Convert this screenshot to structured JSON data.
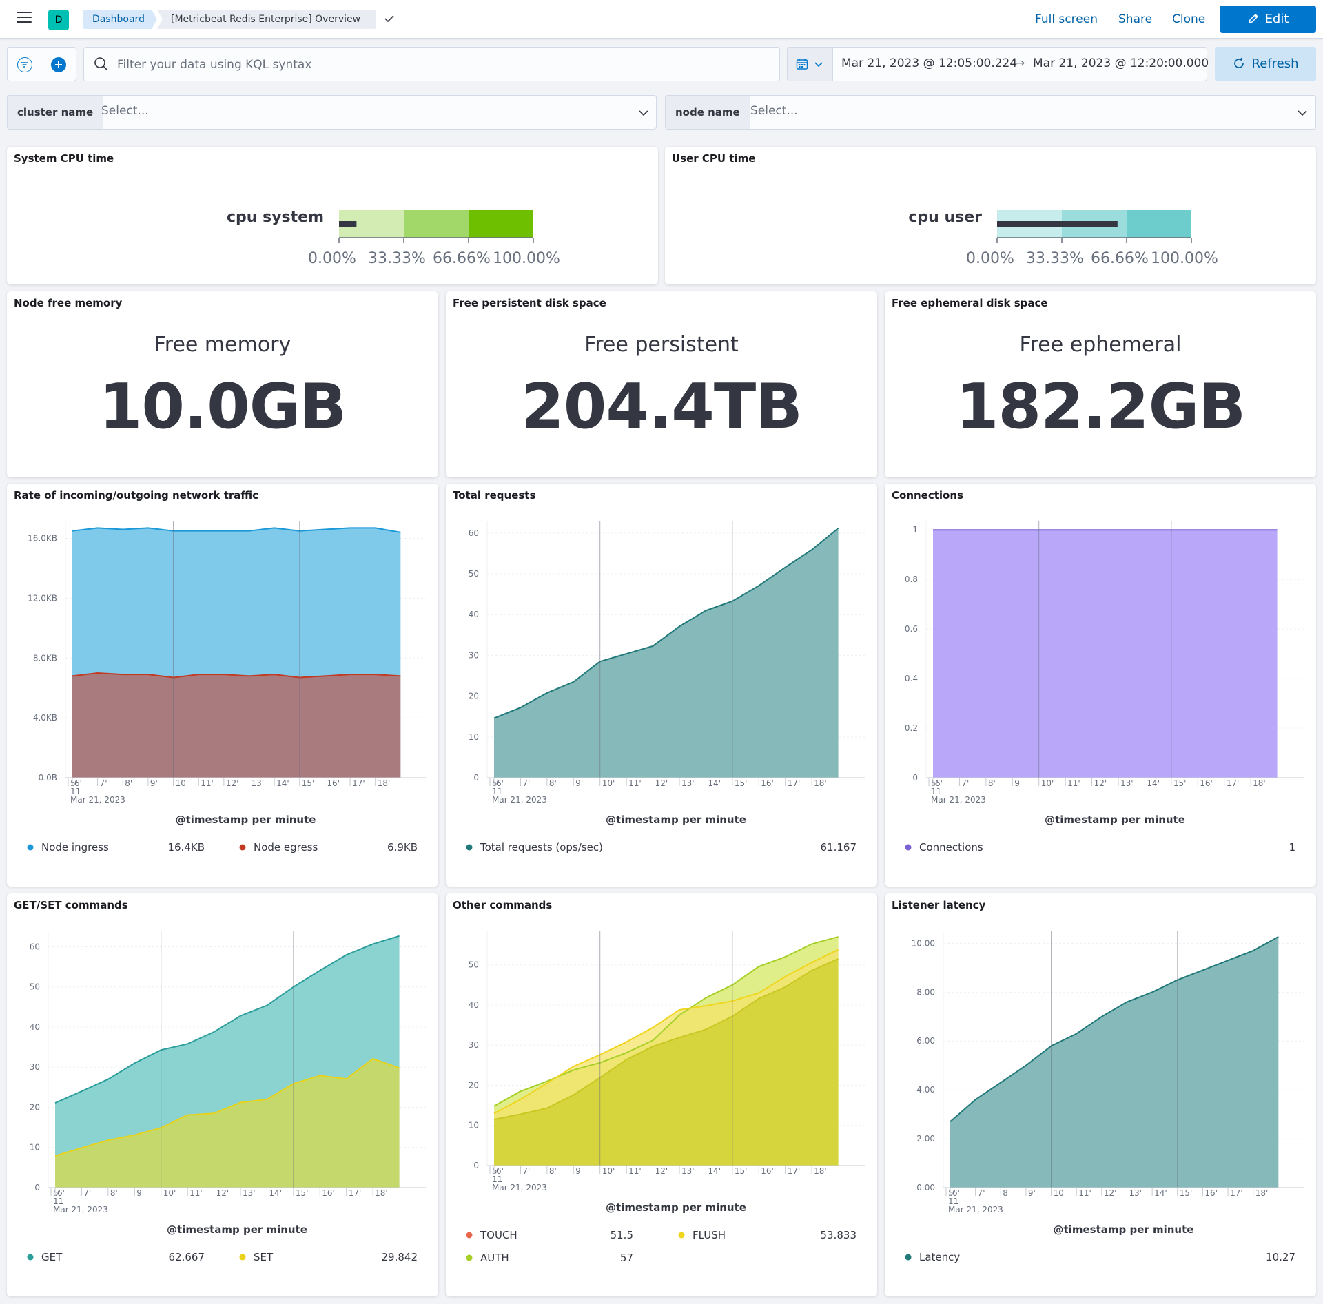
{
  "header": {
    "space_initial": "D",
    "breadcrumb_root": "Dashboard",
    "breadcrumb_current": "[Metricbeat Redis Enterprise] Overview",
    "full_screen_label": "Full screen",
    "share_label": "Share",
    "clone_label": "Clone",
    "edit_label": "Edit"
  },
  "query_bar": {
    "placeholder": "Filter your data using KQL syntax",
    "start_date": "Mar 21, 2023 @ 12:05:00.224",
    "end_date": "Mar 21, 2023 @ 12:20:00.000",
    "arrow": "→",
    "refresh_label": "Refresh"
  },
  "controls": {
    "cluster_label": "cluster name",
    "cluster_value": "Select...",
    "node_label": "node name",
    "node_value": "Select..."
  },
  "gauges": {
    "system": {
      "panel_title": "System CPU time",
      "label": "cpu system",
      "ticks": [
        "0.00%",
        "33.33%",
        "66.66%",
        "100.00%"
      ],
      "value_fraction": 0.09,
      "band_colors": [
        "#d2ecb4",
        "#a2d86a",
        "#6dbf00"
      ]
    },
    "user": {
      "panel_title": "User CPU time",
      "label": "cpu user",
      "ticks": [
        "0.00%",
        "33.33%",
        "66.66%",
        "100.00%"
      ],
      "value_fraction": 0.62,
      "band_colors": [
        "#c6ecec",
        "#9bdddd",
        "#6dcccc"
      ]
    }
  },
  "metrics": {
    "memory": {
      "panel_title": "Node free memory",
      "label": "Free memory",
      "value": "10.0GB"
    },
    "persistent": {
      "panel_title": "Free persistent disk space",
      "label": "Free persistent",
      "value": "204.4TB"
    },
    "ephemeral": {
      "panel_title": "Free ephemeral disk space",
      "label": "Free ephemeral",
      "value": "182.2GB"
    }
  },
  "chart_data": [
    {
      "id": "network",
      "panel_title": "Rate of incoming/outgoing network traffic",
      "type": "area",
      "stacked": true,
      "x": [
        "5'",
        "6'",
        "7'",
        "8'",
        "9'",
        "10'",
        "11'",
        "12'",
        "13'",
        "14'",
        "15'",
        "16'",
        "17'",
        "18'"
      ],
      "x_start_label": "Mar 21, 2023",
      "x_start_sub": "11",
      "xlabel": "@timestamp per minute",
      "y_ticks": [
        "0.0B",
        "4.0KB",
        "8.0KB",
        "12.0KB",
        "16.0KB"
      ],
      "ylim": [
        0,
        16.9
      ],
      "series": [
        {
          "name": "Node egress",
          "color": "#aa7b7e",
          "line": "#c33a22",
          "values": [
            6.8,
            7.0,
            6.9,
            6.9,
            6.7,
            6.9,
            6.9,
            6.8,
            6.9,
            6.7,
            6.8,
            6.9,
            6.9,
            6.8
          ]
        },
        {
          "name": "Node ingress",
          "color": "#7fcaeb",
          "line": "#1b98d8",
          "values": [
            9.7,
            9.7,
            9.7,
            9.8,
            9.8,
            9.6,
            9.6,
            9.7,
            9.8,
            9.8,
            9.8,
            9.8,
            9.8,
            9.6
          ]
        }
      ],
      "legend": [
        {
          "name": "Node ingress",
          "value": "16.4KB",
          "color": "#1b98d8"
        },
        {
          "name": "Node egress",
          "value": "6.9KB",
          "color": "#c33a22"
        }
      ]
    },
    {
      "id": "requests",
      "panel_title": "Total requests",
      "type": "area",
      "x": [
        "5'",
        "6'",
        "7'",
        "8'",
        "9'",
        "10'",
        "11'",
        "12'",
        "13'",
        "14'",
        "15'",
        "16'",
        "17'",
        "18'"
      ],
      "x_start_label": "Mar 21, 2023",
      "x_start_sub": "11",
      "xlabel": "@timestamp per minute",
      "y_ticks": [
        "0",
        "10",
        "20",
        "30",
        "40",
        "50",
        "60"
      ],
      "ylim": [
        0,
        62
      ],
      "series": [
        {
          "name": "Total requests (ops/sec)",
          "color": "#86b9ba",
          "line": "#21797a",
          "values": [
            14.6,
            17.2,
            20.8,
            23.5,
            28.5,
            30.4,
            32.3,
            37.1,
            41.0,
            43.3,
            47.1,
            51.6,
            55.9,
            61.2
          ]
        }
      ],
      "legend": [
        {
          "name": "Total requests (ops/sec)",
          "value": "61.167",
          "color": "#21797a"
        }
      ]
    },
    {
      "id": "connections",
      "panel_title": "Connections",
      "type": "area",
      "x": [
        "5'",
        "6'",
        "7'",
        "8'",
        "9'",
        "10'",
        "11'",
        "12'",
        "13'",
        "14'",
        "15'",
        "16'",
        "17'",
        "18'"
      ],
      "x_start_label": "Mar 21, 2023",
      "x_start_sub": "11",
      "xlabel": "@timestamp per minute",
      "y_ticks": [
        "0",
        "0.2",
        "0.4",
        "0.6",
        "0.8",
        "1"
      ],
      "ylim": [
        0,
        1.02
      ],
      "series": [
        {
          "name": "Connections",
          "color": "#b9a8fa",
          "line": "#7b62d5",
          "values": [
            1,
            1,
            1,
            1,
            1,
            1,
            1,
            1,
            1,
            1,
            1,
            1,
            1,
            1
          ]
        }
      ],
      "legend": [
        {
          "name": "Connections",
          "value": "1",
          "color": "#7b62d5"
        }
      ]
    },
    {
      "id": "getset",
      "panel_title": "GET/SET commands",
      "type": "area",
      "x": [
        "5'",
        "6'",
        "7'",
        "8'",
        "9'",
        "10'",
        "11'",
        "12'",
        "13'",
        "14'",
        "15'",
        "16'",
        "17'",
        "18'"
      ],
      "x_start_label": "Mar 21, 2023",
      "x_start_sub": "11",
      "xlabel": "@timestamp per minute",
      "y_ticks": [
        "0",
        "10",
        "20",
        "30",
        "40",
        "50",
        "60"
      ],
      "ylim": [
        0,
        63
      ],
      "series": [
        {
          "name": "GET",
          "color": "#8ad3d1",
          "line": "#2c9e9c",
          "values": [
            21.1,
            24.0,
            27.0,
            31.0,
            34.3,
            35.8,
            38.8,
            42.8,
            45.4,
            50.0,
            54.1,
            58.0,
            60.7,
            62.7
          ]
        },
        {
          "name": "SET",
          "color": "#c5d86c",
          "line": "#e9d31a",
          "values": [
            7.9,
            9.9,
            11.8,
            13.1,
            14.9,
            18.1,
            18.5,
            21.2,
            22.0,
            25.9,
            27.9,
            27.1,
            32.1,
            29.8
          ]
        }
      ],
      "legend": [
        {
          "name": "GET",
          "value": "62.667",
          "color": "#2c9e9c"
        },
        {
          "name": "SET",
          "value": "29.842",
          "color": "#e9d31a"
        }
      ]
    },
    {
      "id": "other",
      "panel_title": "Other commands",
      "type": "area",
      "x": [
        "5'",
        "6'",
        "7'",
        "8'",
        "9'",
        "10'",
        "11'",
        "12'",
        "13'",
        "14'",
        "15'",
        "16'",
        "17'",
        "18'"
      ],
      "x_start_label": "Mar 21, 2023",
      "x_start_sub": "11",
      "xlabel": "@timestamp per minute",
      "y_ticks": [
        "0",
        "10",
        "20",
        "30",
        "40",
        "50"
      ],
      "ylim": [
        0,
        57.5
      ],
      "series": [
        {
          "name": "AUTH",
          "color": "#d4e862",
          "line": "#a6cf28",
          "values": [
            14.8,
            18.5,
            21.0,
            23.8,
            25.6,
            28.1,
            31.2,
            37.5,
            41.8,
            45.0,
            49.6,
            52.0,
            55.2,
            57.0
          ]
        },
        {
          "name": "FLUSH",
          "color": "#f4e36a",
          "line": "#f0d51e",
          "values": [
            13.0,
            16.5,
            20.5,
            24.7,
            27.6,
            30.8,
            34.4,
            38.8,
            39.8,
            41.0,
            43.0,
            47.1,
            50.6,
            53.8
          ]
        },
        {
          "name": "TOUCH",
          "color": "#cfcf2c",
          "line": "#c9c721",
          "values": [
            11.5,
            12.8,
            14.3,
            17.6,
            21.9,
            26.4,
            29.7,
            31.9,
            33.9,
            37.2,
            41.6,
            44.5,
            48.6,
            51.5
          ]
        }
      ],
      "legend": [
        {
          "name": "TOUCH",
          "value": "51.5",
          "color": "#e7664c"
        },
        {
          "name": "FLUSH",
          "value": "53.833",
          "color": "#f0d51e"
        },
        {
          "name": "AUTH",
          "value": "57",
          "color": "#a6cf28"
        }
      ]
    },
    {
      "id": "latency",
      "panel_title": "Listener latency",
      "type": "area",
      "x": [
        "5'",
        "6'",
        "7'",
        "8'",
        "9'",
        "10'",
        "11'",
        "12'",
        "13'",
        "14'",
        "15'",
        "16'",
        "17'",
        "18'"
      ],
      "x_start_label": "Mar 21, 2023",
      "x_start_sub": "11",
      "xlabel": "@timestamp per minute",
      "y_ticks": [
        "0.00",
        "2.00",
        "4.00",
        "6.00",
        "8.00",
        "10.00"
      ],
      "ylim": [
        0,
        10.35
      ],
      "series": [
        {
          "name": "Latency",
          "color": "#86b9ba",
          "line": "#21797a",
          "values": [
            2.7,
            3.6,
            4.3,
            5.0,
            5.8,
            6.3,
            7.0,
            7.6,
            8.0,
            8.5,
            8.9,
            9.3,
            9.7,
            10.27
          ]
        }
      ],
      "legend": [
        {
          "name": "Latency",
          "value": "10.27",
          "color": "#21797a"
        }
      ]
    }
  ]
}
